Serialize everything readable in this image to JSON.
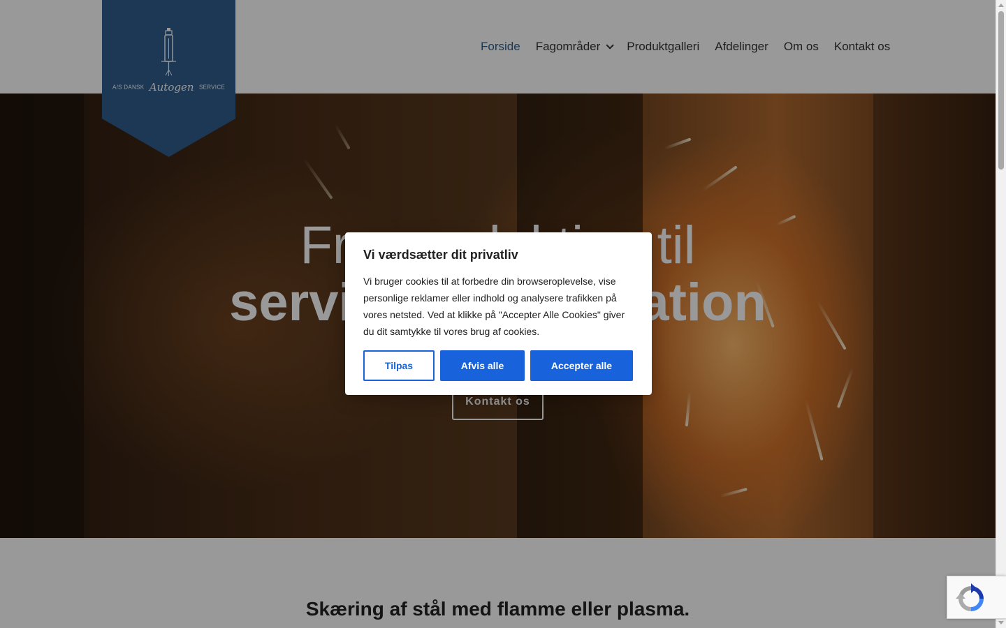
{
  "brand": {
    "logo_left": "A/S DANSK",
    "logo_script": "Autogen",
    "logo_right": "SERVICE",
    "banner_color": "#2f5e8e"
  },
  "nav": {
    "items": [
      {
        "label": "Forside",
        "active": true
      },
      {
        "label": "Fagområder",
        "has_dropdown": true
      },
      {
        "label": "Produktgalleri"
      },
      {
        "label": "Afdelinger"
      },
      {
        "label": "Om os"
      },
      {
        "label": "Kontakt os"
      }
    ],
    "active_color": "#2b5f8f"
  },
  "hero": {
    "title_line1": "Fra produktion til",
    "title_line2": "service og reparation",
    "cta_label": "Kontakt os"
  },
  "section": {
    "title": "Skæring af stål med flamme eller plasma."
  },
  "cookie_modal": {
    "title": "Vi værdsætter dit privatliv",
    "body": "Vi bruger cookies til at forbedre din browseroplevelse, vise personlige reklamer eller indhold og analysere trafikken på vores netsted. Ved at klikke på \"Accepter Alle Cookies\" giver du dit samtykke til vores brug af cookies.",
    "customize_label": "Tilpas",
    "reject_label": "Afvis alle",
    "accept_label": "Accepter alle",
    "accent_color": "#1863dc"
  },
  "icons": {
    "recaptcha": "recaptcha-icon",
    "dropdown": "chevron-down-icon"
  }
}
